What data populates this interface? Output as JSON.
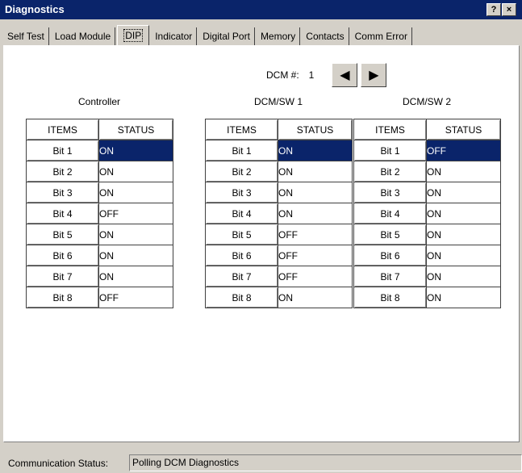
{
  "window": {
    "title": "Diagnostics",
    "help_label": "?",
    "close_label": "×"
  },
  "tabs": [
    {
      "label": "Self Test"
    },
    {
      "label": "Load Module"
    },
    {
      "label": "DIP"
    },
    {
      "label": "Indicator"
    },
    {
      "label": "Digital Port"
    },
    {
      "label": "Memory"
    },
    {
      "label": "Contacts"
    },
    {
      "label": "Comm Error"
    }
  ],
  "active_tab": "DIP",
  "dcm": {
    "label": "DCM #:",
    "value": "1",
    "prev_icon": "◀",
    "next_icon": "▶"
  },
  "tables": [
    {
      "title": "Controller",
      "headers": [
        "ITEMS",
        "STATUS"
      ],
      "rows": [
        [
          "Bit 1",
          "ON"
        ],
        [
          "Bit 2",
          "ON"
        ],
        [
          "Bit 3",
          "ON"
        ],
        [
          "Bit 4",
          "OFF"
        ],
        [
          "Bit 5",
          "ON"
        ],
        [
          "Bit 6",
          "ON"
        ],
        [
          "Bit 7",
          "ON"
        ],
        [
          "Bit 8",
          "OFF"
        ]
      ]
    },
    {
      "title": "DCM/SW 1",
      "headers": [
        "ITEMS",
        "STATUS"
      ],
      "rows": [
        [
          "Bit 1",
          "ON"
        ],
        [
          "Bit 2",
          "ON"
        ],
        [
          "Bit 3",
          "ON"
        ],
        [
          "Bit 4",
          "ON"
        ],
        [
          "Bit 5",
          "OFF"
        ],
        [
          "Bit 6",
          "OFF"
        ],
        [
          "Bit 7",
          "OFF"
        ],
        [
          "Bit 8",
          "ON"
        ]
      ]
    },
    {
      "title": "DCM/SW 2",
      "headers": [
        "ITEMS",
        "STATUS"
      ],
      "rows": [
        [
          "Bit 1",
          "OFF"
        ],
        [
          "Bit 2",
          "ON"
        ],
        [
          "Bit 3",
          "ON"
        ],
        [
          "Bit 4",
          "ON"
        ],
        [
          "Bit 5",
          "ON"
        ],
        [
          "Bit 6",
          "ON"
        ],
        [
          "Bit 7",
          "ON"
        ],
        [
          "Bit 8",
          "ON"
        ]
      ]
    }
  ],
  "statusbar": {
    "label": "Communication Status:",
    "value": "Polling DCM Diagnostics"
  },
  "colors": {
    "titlebar": "#0a246a",
    "selection": "#0a246a",
    "face": "#d4d0c8"
  }
}
